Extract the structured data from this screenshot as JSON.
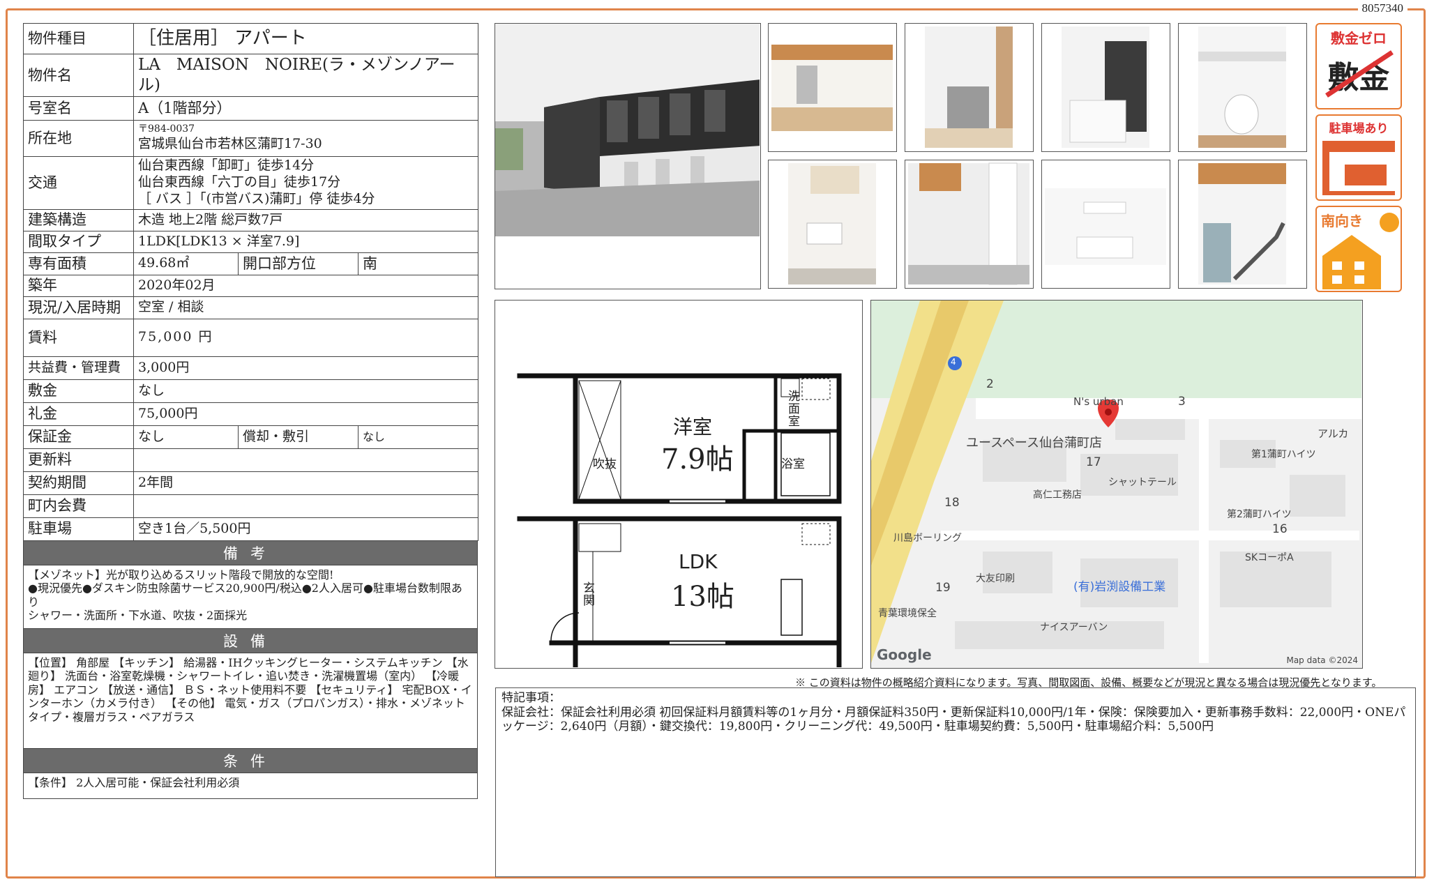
{
  "doc_id": "8057340",
  "labels": {
    "type": "物件種目",
    "name": "物件名",
    "room": "号室名",
    "address": "所在地",
    "access": "交通",
    "structure": "建築構造",
    "layout": "間取タイプ",
    "area": "専有面積",
    "direction": "開口部方位",
    "built": "築年",
    "status": "現況/入居時期",
    "rent": "賃料",
    "common_fee": "共益費・管理費",
    "deposit": "敷金",
    "key_money": "礼金",
    "guarantee": "保証金",
    "amortization": "償却・敷引",
    "renewal": "更新料",
    "contract": "契約期間",
    "community": "町内会費",
    "parking": "駐車場"
  },
  "values": {
    "type": "［住居用］ アパート",
    "name": "LA　MAISON　NOIRE(ラ・メゾンノアール)",
    "room": "A（1階部分）",
    "postal": "〒984-0037",
    "address": "宮城県仙台市若林区蒲町17-30",
    "access1": "仙台東西線「卸町」徒歩14分",
    "access2": "仙台東西線「六丁の目」徒歩17分",
    "access3": "［ バス ］「(市営バス)蒲町」停 徒歩4分",
    "structure": "木造 地上2階 総戸数7戸",
    "layout": "1LDK[LDK13 × 洋室7.9]",
    "area": "49.68㎡",
    "direction": "南",
    "built": "2020年02月",
    "status": "空室 / 相談",
    "rent": "75,000 円",
    "common_fee": "3,000円",
    "deposit": "なし",
    "key_money": "75,000円",
    "guarantee": "なし",
    "amortization": "なし",
    "renewal": "",
    "contract": "2年間",
    "community": "",
    "parking": "空き1台／5,500円"
  },
  "sections": {
    "remarks_title": "備考",
    "remarks1": "【メゾネット】光が取り込めるスリット階段で開放的な空間!",
    "remarks2": "●現況優先●ダスキン防虫除菌サービス20,900円/税込●2人入居可●駐車場台数制限あり",
    "remarks3": "シャワー・洗面所・下水道、吹抜・2面採光",
    "equip_title": "設備",
    "equip": "【位置】 角部屋 【キッチン】 給湯器・IHクッキングヒーター・システムキッチン 【水廻り】 洗面台・浴室乾燥機・シャワートイレ・追い焚き・洗濯機置場（室内） 【冷暖房】 エアコン 【放送・通信】 ＢＳ・ネット使用料不要 【セキュリティ】 宅配BOX・インターホン（カメラ付き） 【その他】 電気・ガス（プロパンガス）・排水・メゾネットタイプ・複層ガラス・ペアガラス",
    "cond_title": "条件",
    "cond": "【条件】 2人入居可能・保証会社利用必須"
  },
  "floorplan": {
    "room1": "洋室",
    "room1_size": "7.9帖",
    "room2": "LDK",
    "room2_size": "13帖",
    "fukinuke": "吹抜",
    "bath": "浴室",
    "senmen": "洗面室",
    "genkan": "玄関"
  },
  "map": {
    "labels": [
      "2",
      "3",
      "N's urban",
      "ユースペース仙台蒲町店",
      "17",
      "シャットテール",
      "高仁工務店",
      "18",
      "川島ボーリング",
      "第1蒲町ハイツ",
      "アルカ",
      "第2蒲町ハイツ",
      "16",
      "SKコーポA",
      "大友印刷",
      "19",
      "(有)岩渕設備工業",
      "青葉環境保全",
      "ナイスアーバン",
      "Google",
      "Map data ©2024",
      "4"
    ]
  },
  "badges": {
    "b1_top": "敷金ゼロ",
    "b1_main": "敷金",
    "b2": "駐車場あり",
    "b3": "南向き"
  },
  "note": "※ この資料は物件の概略紹介資料になります。写真、間取図面、設備、概要などが現況と異なる場合は現況優先となります。",
  "special": {
    "title": "特記事項：",
    "body": "保証会社：保証会社利用必須 初回保証料月額賃料等の1ヶ月分・月額保証料350円・更新保証料10,000円/1年・保険：保険要加入・更新事務手数料：22,000円・ONEパッケージ：2,640円（月額）・鍵交換代：19,800円・クリーニング代：49,500円・駐車場契約費：5,500円・駐車場紹介料：5,500円"
  },
  "colors": {
    "accent": "#e0844a",
    "section": "#6b6b6b",
    "pin": "#e53935"
  }
}
